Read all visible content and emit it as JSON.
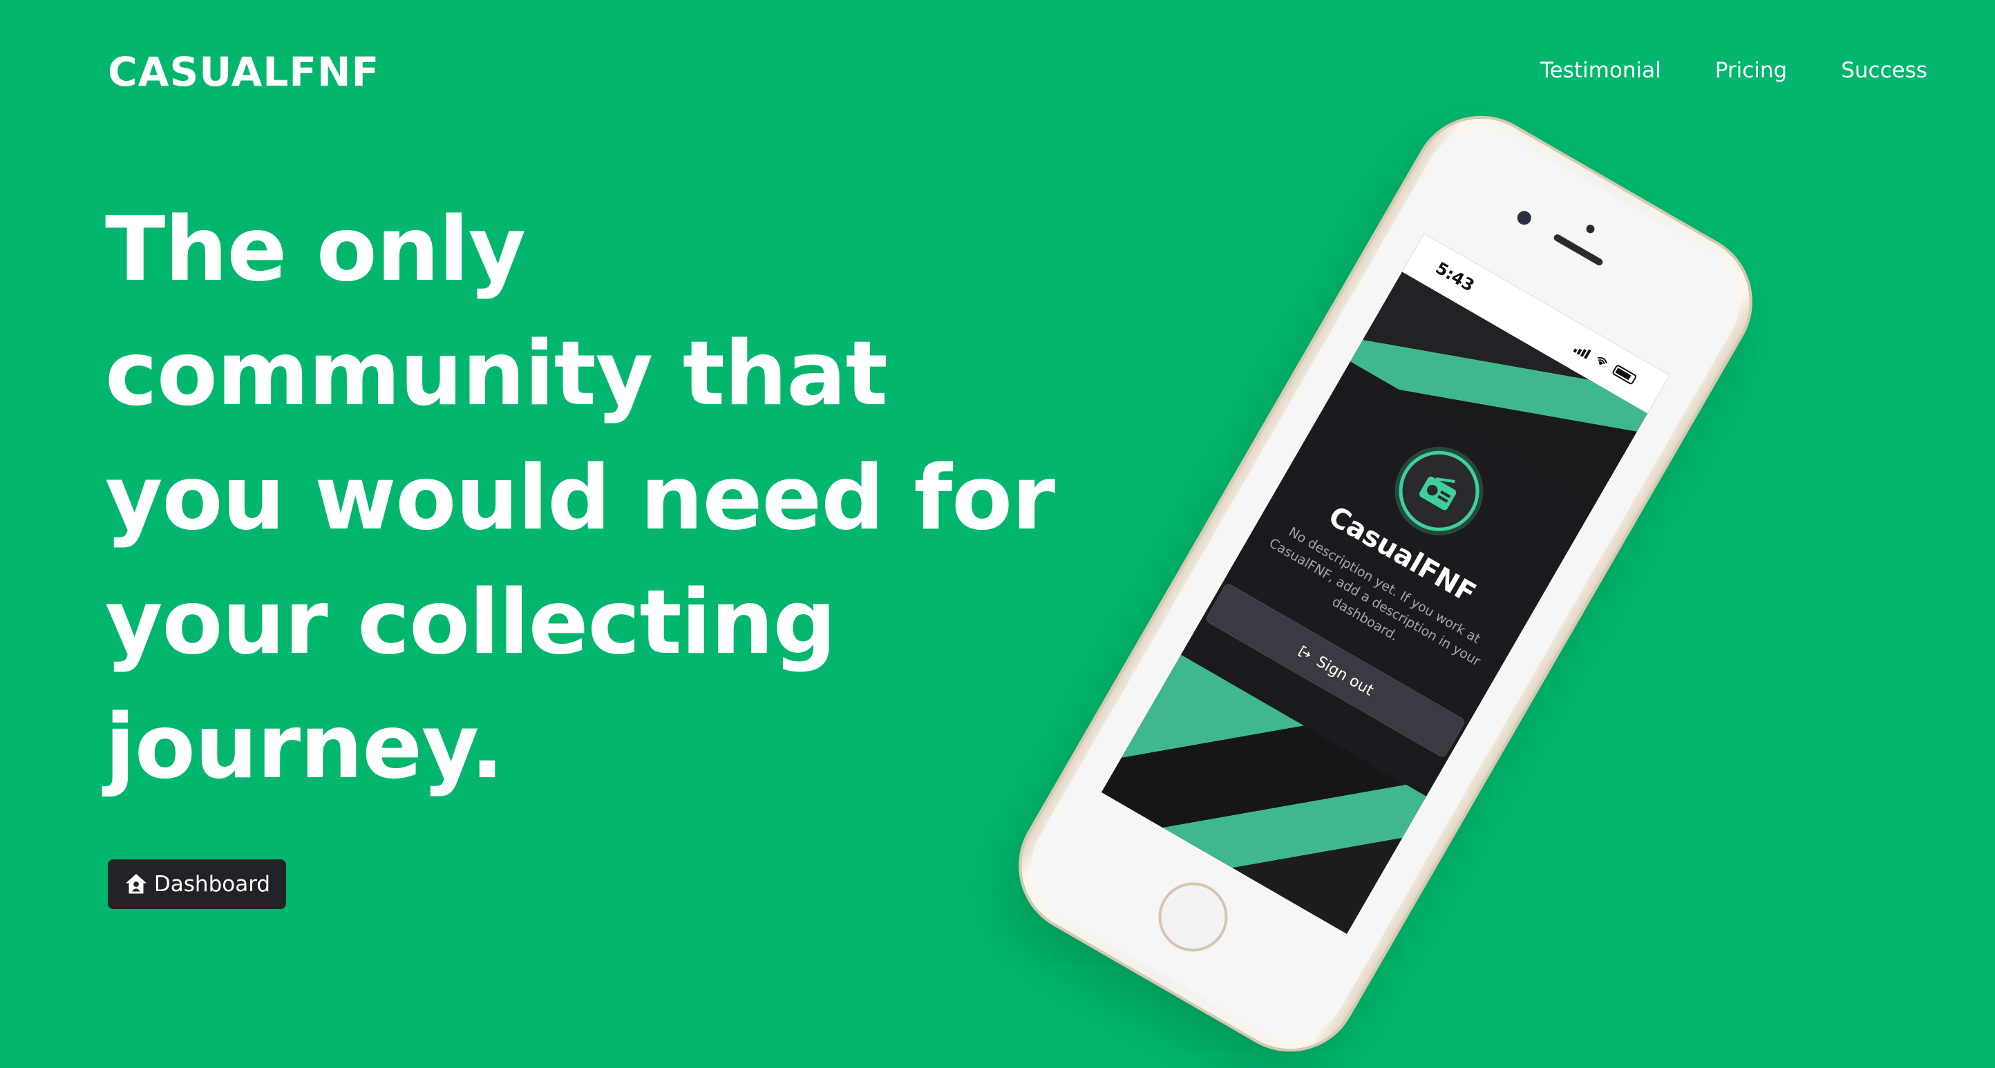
{
  "header": {
    "logo": "CASUALFNF",
    "nav": [
      "Testimonial",
      "Pricing",
      "Success"
    ]
  },
  "hero": {
    "lines": [
      "The only",
      "community that",
      "you would need for",
      "your collecting",
      "journey."
    ],
    "button_label": "Dashboard",
    "button_icon": "house-user-icon"
  },
  "phone": {
    "status_time": "5:43",
    "org_name": "CasualFNF",
    "org_description": "No description yet. If you work at CasualFNF, add a description in your dashboard.",
    "signout_label": "Sign out",
    "signout_icon": "sign-out-icon",
    "avatar_icon": "radio-icon"
  },
  "colors": {
    "background": "#02b76d",
    "button": "#222227",
    "accent": "#3fcf9a"
  }
}
